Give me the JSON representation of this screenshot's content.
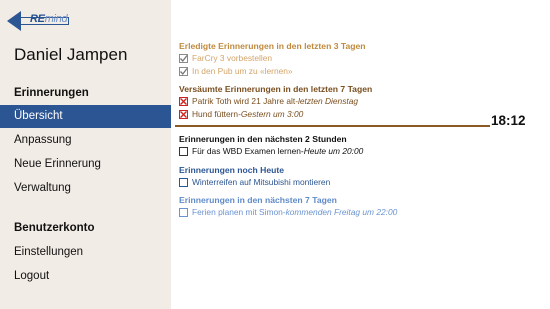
{
  "app": {
    "logo_text_bold": "RE",
    "logo_text_thin": "mind",
    "user_name": "Daniel Jampen"
  },
  "sidebar": {
    "section1": "Erinnerungen",
    "items1": [
      {
        "label": "Übersicht",
        "active": true
      },
      {
        "label": "Anpassung",
        "active": false
      },
      {
        "label": "Neue Erinnerung",
        "active": false
      },
      {
        "label": "Verwaltung",
        "active": false
      }
    ],
    "section2": "Benutzerkonto",
    "items2": [
      {
        "label": "Einstellungen"
      },
      {
        "label": "Logout"
      }
    ]
  },
  "main": {
    "current_time": "18:12",
    "groups": {
      "done": {
        "title": "Erledigte Erinnerungen in den letzten 3 Tagen",
        "items": [
          {
            "text": "FarCry 3 vorbestellen",
            "when": "",
            "state": "checked"
          },
          {
            "text": "In den Pub um zu «lernen»",
            "when": "",
            "state": "checked"
          }
        ]
      },
      "missed": {
        "title": "Versäumte Erinnerungen in den letzten 7 Tagen",
        "items": [
          {
            "text": "Patrik Toth wird 21 Jahre alt",
            "when": "letzten Dienstag",
            "state": "missed"
          },
          {
            "text": "Hund füttern",
            "when": "Gestern um 3:00",
            "state": "missed"
          }
        ]
      },
      "next2h": {
        "title": "Erinnerungen in den nächsten 2 Stunden",
        "items": [
          {
            "text": "Für das WBD Examen lernen",
            "when": "Heute um 20:00",
            "state": "open"
          }
        ]
      },
      "today": {
        "title": "Erinnerungen noch Heute",
        "items": [
          {
            "text": "Winterreifen auf Mitsubishi montieren",
            "when": "",
            "state": "open"
          }
        ]
      },
      "week": {
        "title": "Erinnerungen in den nächsten 7 Tagen",
        "items": [
          {
            "text": "Ferien planen mit Simon",
            "when": "kommenden Freitag um 22:00",
            "state": "open"
          }
        ]
      }
    },
    "separator": " - "
  },
  "colors": {
    "accent": "#2c5693",
    "sidebar_bg": "#f2ece6",
    "done": "#c08a3e",
    "missed": "#7a4e1e",
    "missed_mark": "#cc2222",
    "today": "#2c5693",
    "week": "#5f8bc9",
    "timeline": "#8a5a25"
  }
}
